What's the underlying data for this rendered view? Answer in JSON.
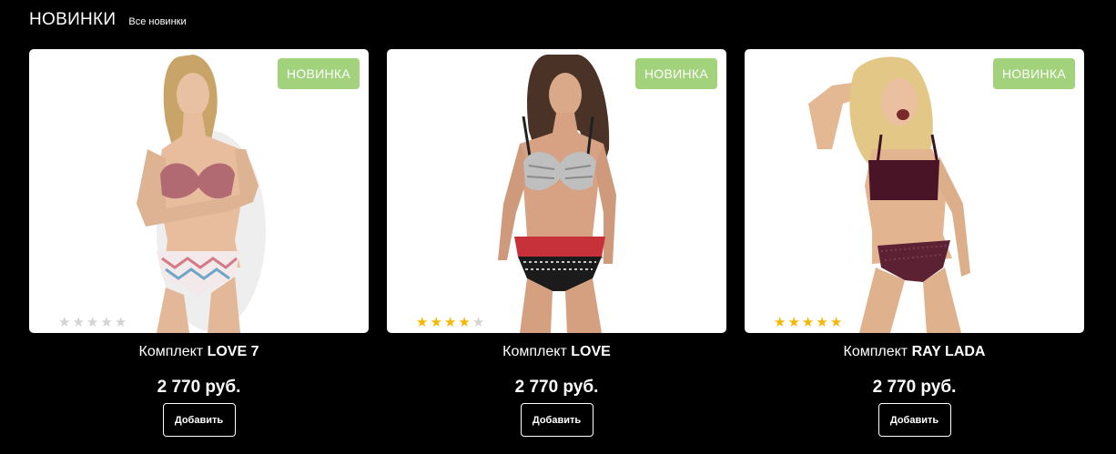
{
  "section": {
    "title": "НОВИНКИ",
    "all_link": "Все новинки"
  },
  "colors": {
    "background": "#000000",
    "badge": "#a3d27c",
    "star_on": "#f5b800",
    "star_off": "#d3d3d3"
  },
  "products": [
    {
      "badge": "НОВИНКА",
      "name_prefix": "Комплект ",
      "name_bold": "LOVE 7",
      "price": "2 770 руб.",
      "button": "Добавить",
      "rating": 0,
      "max_rating": 5,
      "image": "model-pink-bra-chevron-panty"
    },
    {
      "badge": "НОВИНКА",
      "name_prefix": "Комплект ",
      "name_bold": "LOVE",
      "price": "2 770 руб.",
      "button": "Добавить",
      "rating": 4,
      "max_rating": 5,
      "image": "model-grey-bra-red-lace-panty"
    },
    {
      "badge": "НОВИНКА",
      "name_prefix": "Комплект ",
      "name_bold": "RAY LADA",
      "price": "2 770 руб.",
      "button": "Добавить",
      "rating": 5,
      "max_rating": 5,
      "image": "model-burgundy-bralette-set"
    }
  ]
}
